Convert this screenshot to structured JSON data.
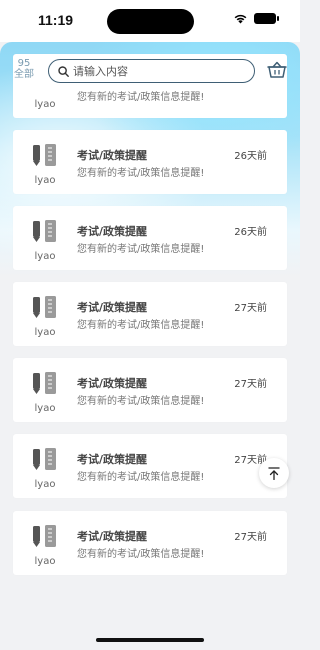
{
  "status_bar": {
    "time": "11:19"
  },
  "header": {
    "count": "95",
    "count_label": "全部",
    "search_placeholder": "请输入内容"
  },
  "messages": [
    {
      "user": "lyao",
      "title": "",
      "time": "",
      "text": "您有新的考试/政策信息提醒!"
    },
    {
      "user": "lyao",
      "title": "考试/政策提醒",
      "time": "26天前",
      "text": "您有新的考试/政策信息提醒!"
    },
    {
      "user": "lyao",
      "title": "考试/政策提醒",
      "time": "26天前",
      "text": "您有新的考试/政策信息提醒!"
    },
    {
      "user": "lyao",
      "title": "考试/政策提醒",
      "time": "27天前",
      "text": "您有新的考试/政策信息提醒!"
    },
    {
      "user": "lyao",
      "title": "考试/政策提醒",
      "time": "27天前",
      "text": "您有新的考试/政策信息提醒!"
    },
    {
      "user": "lyao",
      "title": "考试/政策提醒",
      "time": "27天前",
      "text": "您有新的考试/政策信息提醒!"
    },
    {
      "user": "lyao",
      "title": "考试/政策提醒",
      "time": "27天前",
      "text": "您有新的考试/政策信息提醒!"
    }
  ],
  "icons": {
    "search": "search-icon",
    "basket": "basket-icon",
    "message": "pencil-ruler-icon",
    "scroll_top": "arrow-up-to-top-icon"
  },
  "colors": {
    "header_gradient": "#8fd8f5",
    "background": "#f1f2f4",
    "card": "#ffffff"
  }
}
